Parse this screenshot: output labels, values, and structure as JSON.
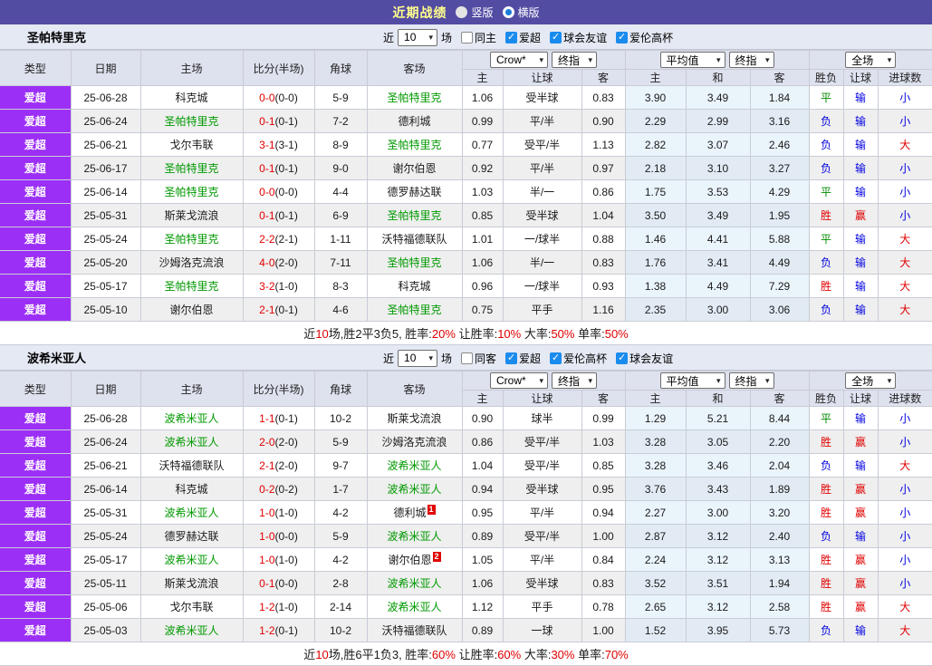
{
  "title_bar": {
    "title": "近期战绩",
    "options": [
      {
        "label": "竖版",
        "selected": false
      },
      {
        "label": "横版",
        "selected": true
      }
    ]
  },
  "icons": {
    "chevron_down": "▾",
    "check": "✓"
  },
  "colors": {
    "titlebar_purple": "#534CA3",
    "type_purple": "#9C2FF6",
    "team_green": "#009900",
    "red": "#E00000",
    "blue": "#0000E0",
    "avg_column_blue": "#EAF4FB"
  },
  "table_header": {
    "type": "类型",
    "date": "日期",
    "home": "主场",
    "score": "比分(半场)",
    "corner": "角球",
    "away": "客场",
    "selects": {
      "bookmaker": "Crow*",
      "final": "终指",
      "average": "平均值",
      "final2": "终指",
      "full": "全场"
    },
    "sub": [
      "主",
      "让球",
      "客",
      "主",
      "和",
      "客",
      "胜负",
      "让球",
      "进球数"
    ]
  },
  "sections": [
    {
      "team": "圣帕特里克",
      "filter": {
        "near": "近",
        "count": "10",
        "unit": "场",
        "checkboxes": [
          {
            "label": "同主",
            "checked": false
          },
          {
            "label": "爱超",
            "checked": true
          },
          {
            "label": "球会友谊",
            "checked": true
          },
          {
            "label": "爱伦高杯",
            "checked": true
          }
        ]
      },
      "rows": [
        {
          "type": "爱超",
          "date": "25-06-28",
          "home": "科克城",
          "home_green": false,
          "home_badge": "",
          "score": "0-0",
          "half": "(0-0)",
          "corner": "5-9",
          "away": "圣帕特里克",
          "away_green": true,
          "away_badge": "",
          "h_home": "1.06",
          "handicap": "受半球",
          "h_away": "0.83",
          "avg_home": "3.90",
          "avg_draw": "3.49",
          "avg_away": "1.84",
          "wdl": "平",
          "cover": "输",
          "goals": "小"
        },
        {
          "type": "爱超",
          "date": "25-06-24",
          "home": "圣帕特里克",
          "home_green": true,
          "home_badge": "",
          "score": "0-1",
          "half": "(0-1)",
          "corner": "7-2",
          "away": "德利城",
          "away_green": false,
          "away_badge": "",
          "h_home": "0.99",
          "handicap": "平/半",
          "h_away": "0.90",
          "avg_home": "2.29",
          "avg_draw": "2.99",
          "avg_away": "3.16",
          "wdl": "负",
          "cover": "输",
          "goals": "小"
        },
        {
          "type": "爱超",
          "date": "25-06-21",
          "home": "戈尔韦联",
          "home_green": false,
          "home_badge": "",
          "score": "3-1",
          "half": "(3-1)",
          "corner": "8-9",
          "away": "圣帕特里克",
          "away_green": true,
          "away_badge": "",
          "h_home": "0.77",
          "handicap": "受平/半",
          "h_away": "1.13",
          "avg_home": "2.82",
          "avg_draw": "3.07",
          "avg_away": "2.46",
          "wdl": "负",
          "cover": "输",
          "goals": "大"
        },
        {
          "type": "爱超",
          "date": "25-06-17",
          "home": "圣帕特里克",
          "home_green": true,
          "home_badge": "",
          "score": "0-1",
          "half": "(0-1)",
          "corner": "9-0",
          "away": "谢尔伯恩",
          "away_green": false,
          "away_badge": "",
          "h_home": "0.92",
          "handicap": "平/半",
          "h_away": "0.97",
          "avg_home": "2.18",
          "avg_draw": "3.10",
          "avg_away": "3.27",
          "wdl": "负",
          "cover": "输",
          "goals": "小"
        },
        {
          "type": "爱超",
          "date": "25-06-14",
          "home": "圣帕特里克",
          "home_green": true,
          "home_badge": "",
          "score": "0-0",
          "half": "(0-0)",
          "corner": "4-4",
          "away": "德罗赫达联",
          "away_green": false,
          "away_badge": "",
          "h_home": "1.03",
          "handicap": "半/一",
          "h_away": "0.86",
          "avg_home": "1.75",
          "avg_draw": "3.53",
          "avg_away": "4.29",
          "wdl": "平",
          "cover": "输",
          "goals": "小"
        },
        {
          "type": "爱超",
          "date": "25-05-31",
          "home": "斯莱戈流浪",
          "home_green": false,
          "home_badge": "",
          "score": "0-1",
          "half": "(0-1)",
          "corner": "6-9",
          "away": "圣帕特里克",
          "away_green": true,
          "away_badge": "",
          "h_home": "0.85",
          "handicap": "受半球",
          "h_away": "1.04",
          "avg_home": "3.50",
          "avg_draw": "3.49",
          "avg_away": "1.95",
          "wdl": "胜",
          "cover": "赢",
          "goals": "小"
        },
        {
          "type": "爱超",
          "date": "25-05-24",
          "home": "圣帕特里克",
          "home_green": true,
          "home_badge": "",
          "score": "2-2",
          "half": "(2-1)",
          "corner": "1-11",
          "away": "沃特福德联队",
          "away_green": false,
          "away_badge": "",
          "h_home": "1.01",
          "handicap": "一/球半",
          "h_away": "0.88",
          "avg_home": "1.46",
          "avg_draw": "4.41",
          "avg_away": "5.88",
          "wdl": "平",
          "cover": "输",
          "goals": "大"
        },
        {
          "type": "爱超",
          "date": "25-05-20",
          "home": "沙姆洛克流浪",
          "home_green": false,
          "home_badge": "",
          "score": "4-0",
          "half": "(2-0)",
          "corner": "7-11",
          "away": "圣帕特里克",
          "away_green": true,
          "away_badge": "",
          "h_home": "1.06",
          "handicap": "半/一",
          "h_away": "0.83",
          "avg_home": "1.76",
          "avg_draw": "3.41",
          "avg_away": "4.49",
          "wdl": "负",
          "cover": "输",
          "goals": "大"
        },
        {
          "type": "爱超",
          "date": "25-05-17",
          "home": "圣帕特里克",
          "home_green": true,
          "home_badge": "",
          "score": "3-2",
          "half": "(1-0)",
          "corner": "8-3",
          "away": "科克城",
          "away_green": false,
          "away_badge": "",
          "h_home": "0.96",
          "handicap": "一/球半",
          "h_away": "0.93",
          "avg_home": "1.38",
          "avg_draw": "4.49",
          "avg_away": "7.29",
          "wdl": "胜",
          "cover": "输",
          "goals": "大"
        },
        {
          "type": "爱超",
          "date": "25-05-10",
          "home": "谢尔伯恩",
          "home_green": false,
          "home_badge": "",
          "score": "2-1",
          "half": "(0-1)",
          "corner": "4-6",
          "away": "圣帕特里克",
          "away_green": true,
          "away_badge": "",
          "h_home": "0.75",
          "handicap": "平手",
          "h_away": "1.16",
          "avg_home": "2.35",
          "avg_draw": "3.00",
          "avg_away": "3.06",
          "wdl": "负",
          "cover": "输",
          "goals": "大"
        }
      ],
      "summary": [
        {
          "t": "近",
          "red": false
        },
        {
          "t": "10",
          "red": true
        },
        {
          "t": "场,胜2平3负5, 胜率:",
          "red": false
        },
        {
          "t": "20%",
          "red": true
        },
        {
          "t": " 让胜率:",
          "red": false
        },
        {
          "t": "10%",
          "red": true
        },
        {
          "t": " 大率:",
          "red": false
        },
        {
          "t": "50%",
          "red": true
        },
        {
          "t": " 单率:",
          "red": false
        },
        {
          "t": "50%",
          "red": true
        }
      ]
    },
    {
      "team": "波希米亚人",
      "filter": {
        "near": "近",
        "count": "10",
        "unit": "场",
        "checkboxes": [
          {
            "label": "同客",
            "checked": false
          },
          {
            "label": "爱超",
            "checked": true
          },
          {
            "label": "爱伦高杯",
            "checked": true
          },
          {
            "label": "球会友谊",
            "checked": true
          }
        ]
      },
      "rows": [
        {
          "type": "爱超",
          "date": "25-06-28",
          "home": "波希米亚人",
          "home_green": true,
          "home_badge": "",
          "score": "1-1",
          "half": "(0-1)",
          "corner": "10-2",
          "away": "斯莱戈流浪",
          "away_green": false,
          "away_badge": "",
          "h_home": "0.90",
          "handicap": "球半",
          "h_away": "0.99",
          "avg_home": "1.29",
          "avg_draw": "5.21",
          "avg_away": "8.44",
          "wdl": "平",
          "cover": "输",
          "goals": "小"
        },
        {
          "type": "爱超",
          "date": "25-06-24",
          "home": "波希米亚人",
          "home_green": true,
          "home_badge": "",
          "score": "2-0",
          "half": "(2-0)",
          "corner": "5-9",
          "away": "沙姆洛克流浪",
          "away_green": false,
          "away_badge": "",
          "h_home": "0.86",
          "handicap": "受平/半",
          "h_away": "1.03",
          "avg_home": "3.28",
          "avg_draw": "3.05",
          "avg_away": "2.20",
          "wdl": "胜",
          "cover": "赢",
          "goals": "小"
        },
        {
          "type": "爱超",
          "date": "25-06-21",
          "home": "沃特福德联队",
          "home_green": false,
          "home_badge": "",
          "score": "2-1",
          "half": "(2-0)",
          "corner": "9-7",
          "away": "波希米亚人",
          "away_green": true,
          "away_badge": "",
          "h_home": "1.04",
          "handicap": "受平/半",
          "h_away": "0.85",
          "avg_home": "3.28",
          "avg_draw": "3.46",
          "avg_away": "2.04",
          "wdl": "负",
          "cover": "输",
          "goals": "大"
        },
        {
          "type": "爱超",
          "date": "25-06-14",
          "home": "科克城",
          "home_green": false,
          "home_badge": "",
          "score": "0-2",
          "half": "(0-2)",
          "corner": "1-7",
          "away": "波希米亚人",
          "away_green": true,
          "away_badge": "",
          "h_home": "0.94",
          "handicap": "受半球",
          "h_away": "0.95",
          "avg_home": "3.76",
          "avg_draw": "3.43",
          "avg_away": "1.89",
          "wdl": "胜",
          "cover": "赢",
          "goals": "小"
        },
        {
          "type": "爱超",
          "date": "25-05-31",
          "home": "波希米亚人",
          "home_green": true,
          "home_badge": "",
          "score": "1-0",
          "half": "(1-0)",
          "corner": "4-2",
          "away": "德利城",
          "away_green": false,
          "away_badge": "1",
          "h_home": "0.95",
          "handicap": "平/半",
          "h_away": "0.94",
          "avg_home": "2.27",
          "avg_draw": "3.00",
          "avg_away": "3.20",
          "wdl": "胜",
          "cover": "赢",
          "goals": "小"
        },
        {
          "type": "爱超",
          "date": "25-05-24",
          "home": "德罗赫达联",
          "home_green": false,
          "home_badge": "",
          "score": "1-0",
          "half": "(0-0)",
          "corner": "5-9",
          "away": "波希米亚人",
          "away_green": true,
          "away_badge": "",
          "h_home": "0.89",
          "handicap": "受平/半",
          "h_away": "1.00",
          "avg_home": "2.87",
          "avg_draw": "3.12",
          "avg_away": "2.40",
          "wdl": "负",
          "cover": "输",
          "goals": "小"
        },
        {
          "type": "爱超",
          "date": "25-05-17",
          "home": "波希米亚人",
          "home_green": true,
          "home_badge": "",
          "score": "1-0",
          "half": "(1-0)",
          "corner": "4-2",
          "away": "谢尔伯恩",
          "away_green": false,
          "away_badge": "2",
          "h_home": "1.05",
          "handicap": "平/半",
          "h_away": "0.84",
          "avg_home": "2.24",
          "avg_draw": "3.12",
          "avg_away": "3.13",
          "wdl": "胜",
          "cover": "赢",
          "goals": "小"
        },
        {
          "type": "爱超",
          "date": "25-05-11",
          "home": "斯莱戈流浪",
          "home_green": false,
          "home_badge": "",
          "score": "0-1",
          "half": "(0-0)",
          "corner": "2-8",
          "away": "波希米亚人",
          "away_green": true,
          "away_badge": "",
          "h_home": "1.06",
          "handicap": "受半球",
          "h_away": "0.83",
          "avg_home": "3.52",
          "avg_draw": "3.51",
          "avg_away": "1.94",
          "wdl": "胜",
          "cover": "赢",
          "goals": "小"
        },
        {
          "type": "爱超",
          "date": "25-05-06",
          "home": "戈尔韦联",
          "home_green": false,
          "home_badge": "",
          "score": "1-2",
          "half": "(1-0)",
          "corner": "2-14",
          "away": "波希米亚人",
          "away_green": true,
          "away_badge": "",
          "h_home": "1.12",
          "handicap": "平手",
          "h_away": "0.78",
          "avg_home": "2.65",
          "avg_draw": "3.12",
          "avg_away": "2.58",
          "wdl": "胜",
          "cover": "赢",
          "goals": "大"
        },
        {
          "type": "爱超",
          "date": "25-05-03",
          "home": "波希米亚人",
          "home_green": true,
          "home_badge": "",
          "score": "1-2",
          "half": "(0-1)",
          "corner": "10-2",
          "away": "沃特福德联队",
          "away_green": false,
          "away_badge": "",
          "h_home": "0.89",
          "handicap": "一球",
          "h_away": "1.00",
          "avg_home": "1.52",
          "avg_draw": "3.95",
          "avg_away": "5.73",
          "wdl": "负",
          "cover": "输",
          "goals": "大"
        }
      ],
      "summary": [
        {
          "t": "近",
          "red": false
        },
        {
          "t": "10",
          "red": true
        },
        {
          "t": "场,胜6平1负3, 胜率:",
          "red": false
        },
        {
          "t": "60%",
          "red": true
        },
        {
          "t": " 让胜率:",
          "red": false
        },
        {
          "t": "60%",
          "red": true
        },
        {
          "t": " 大率:",
          "red": false
        },
        {
          "t": "30%",
          "red": true
        },
        {
          "t": " 单率:",
          "red": false
        },
        {
          "t": "70%",
          "red": true
        }
      ]
    }
  ]
}
